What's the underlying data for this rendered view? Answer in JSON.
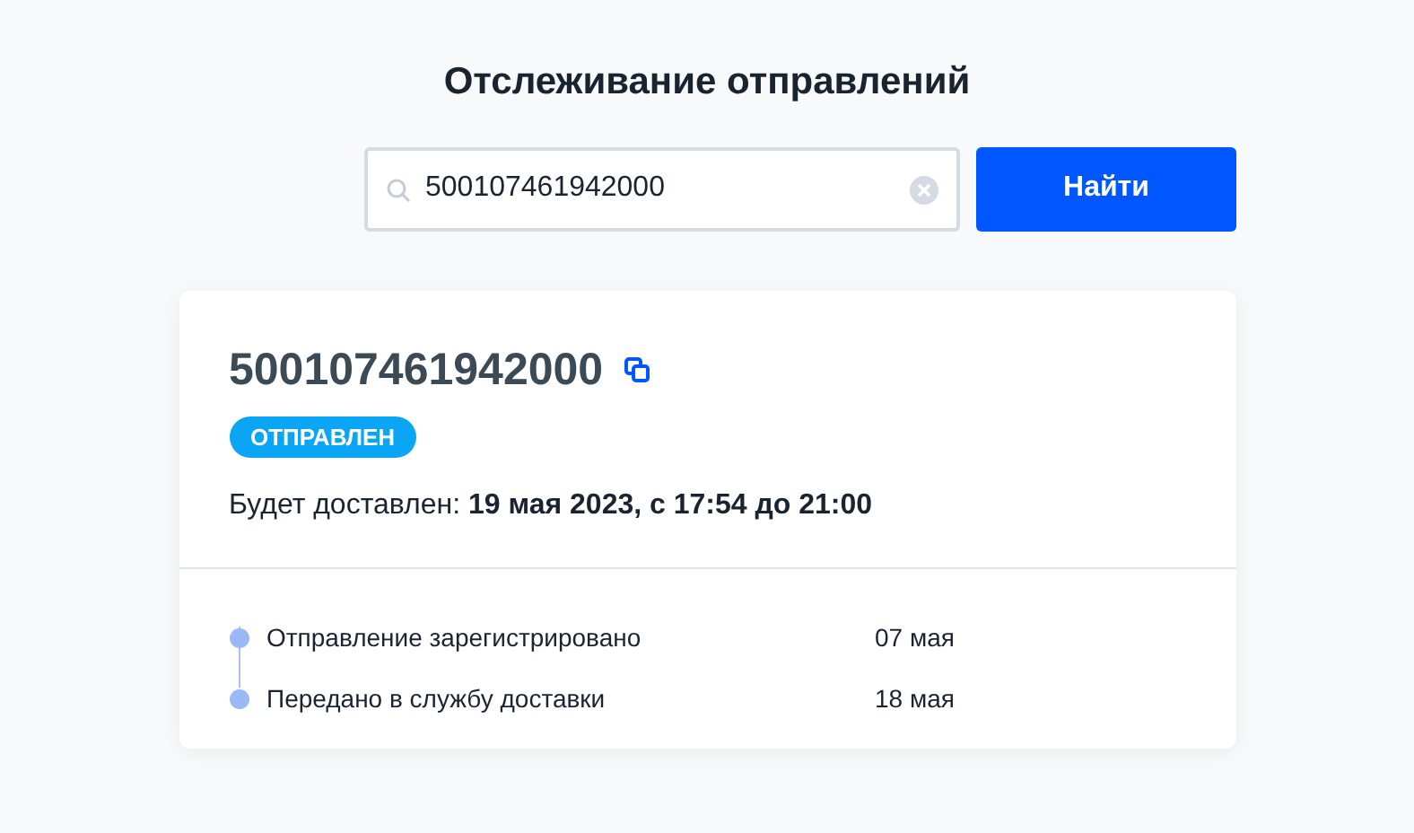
{
  "title": "Отслеживание отправлений",
  "search": {
    "value": "500107461942000",
    "button": "Найти"
  },
  "shipment": {
    "number": "500107461942000",
    "status": "ОТПРАВЛЕН",
    "delivery": "Будет доставлен: **19 мая 2023, с 17:54 до 21:00**",
    "events": [
      {
        "text": "Отправление зарегистрировано",
        "date": "07 мая"
      },
      {
        "text": "Передано в службу доставки",
        "date": "18 мая"
      }
    ]
  }
}
